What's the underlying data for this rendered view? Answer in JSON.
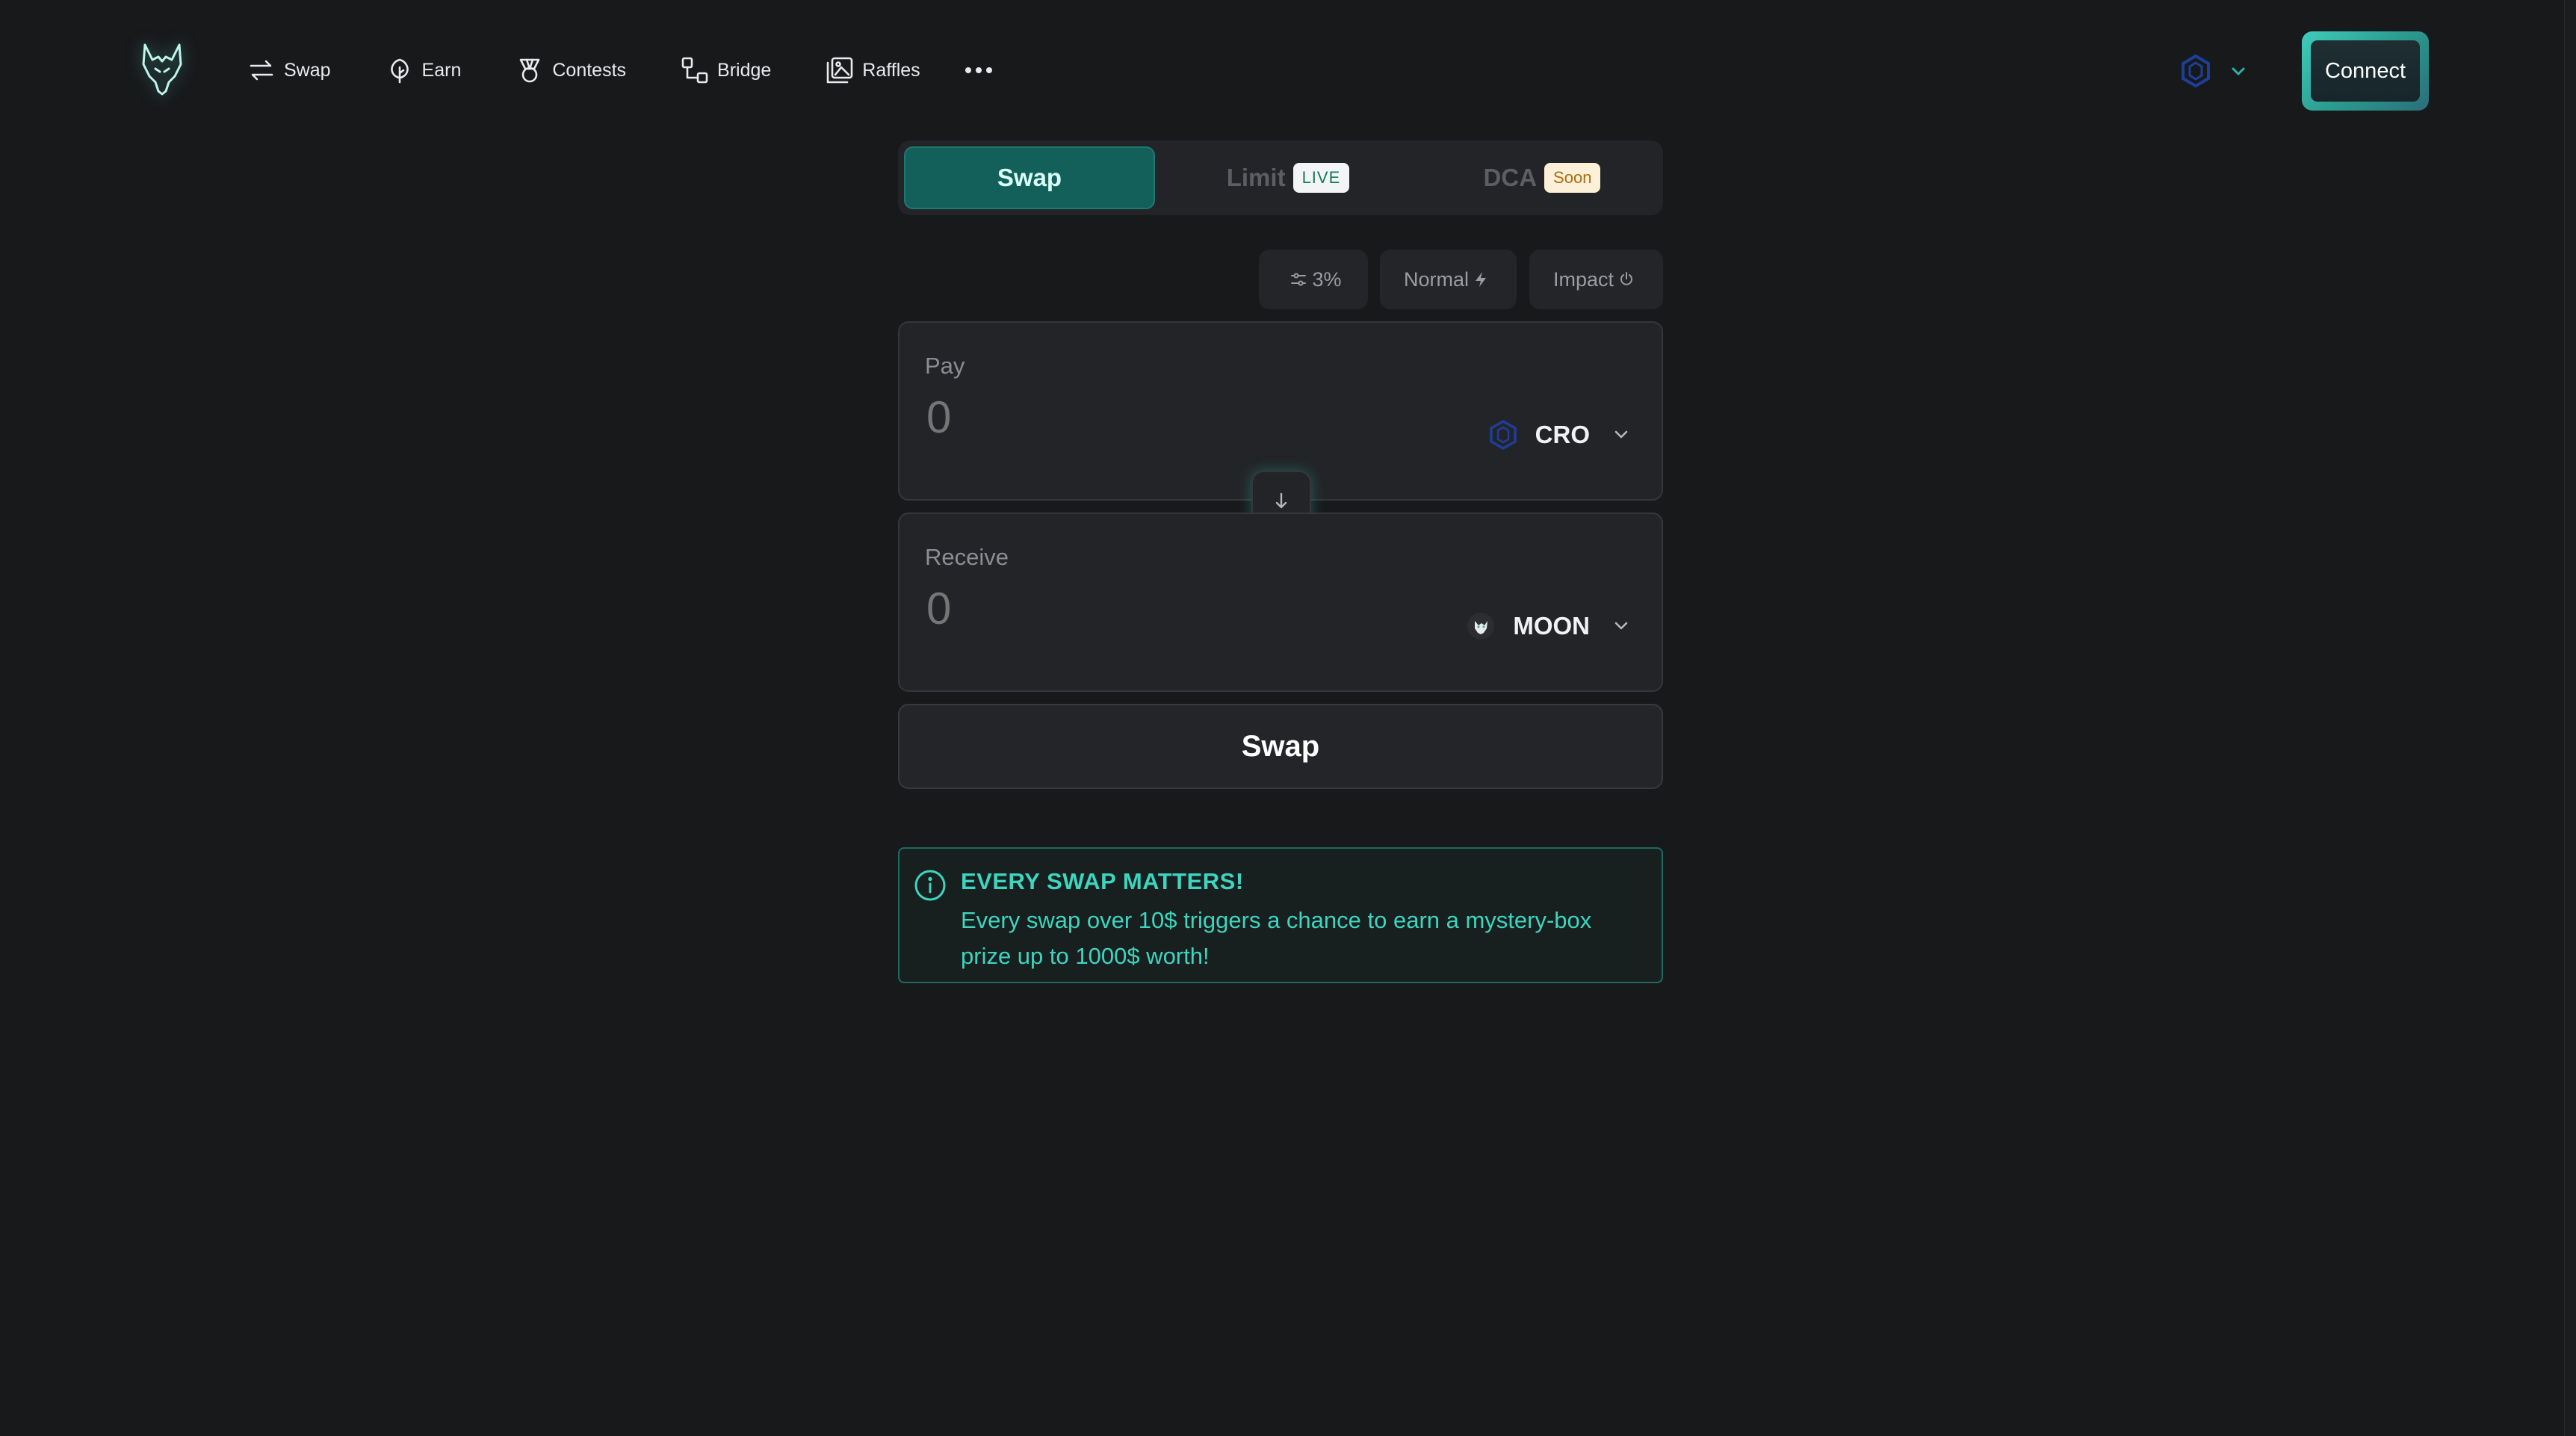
{
  "nav": {
    "items": [
      {
        "label": "Swap",
        "icon": "swap-arrows-icon"
      },
      {
        "label": "Earn",
        "icon": "tree-icon"
      },
      {
        "label": "Contests",
        "icon": "medal-icon"
      },
      {
        "label": "Bridge",
        "icon": "bridge-icon"
      },
      {
        "label": "Raffles",
        "icon": "gallery-icon"
      }
    ],
    "more_icon": "ellipsis-icon",
    "connect_label": "Connect"
  },
  "modes": {
    "swap": "Swap",
    "limit": "Limit",
    "limit_badge": "LIVE",
    "dca": "DCA",
    "dca_badge": "Soon"
  },
  "settings": {
    "slippage": "3%",
    "speed": "Normal",
    "impact": "Impact"
  },
  "pay": {
    "label": "Pay",
    "amount": "0",
    "token": "CRO"
  },
  "receive": {
    "label": "Receive",
    "amount": "0",
    "token": "MOON"
  },
  "swap_button": "Swap",
  "info": {
    "title": "EVERY SWAP MATTERS!",
    "body": "Every swap over 10$ triggers a chance to earn a mystery-box prize up to 1000$ worth!"
  },
  "colors": {
    "background": "#18191b",
    "accent": "#3dd5bf",
    "active_tab": "#135f59"
  }
}
